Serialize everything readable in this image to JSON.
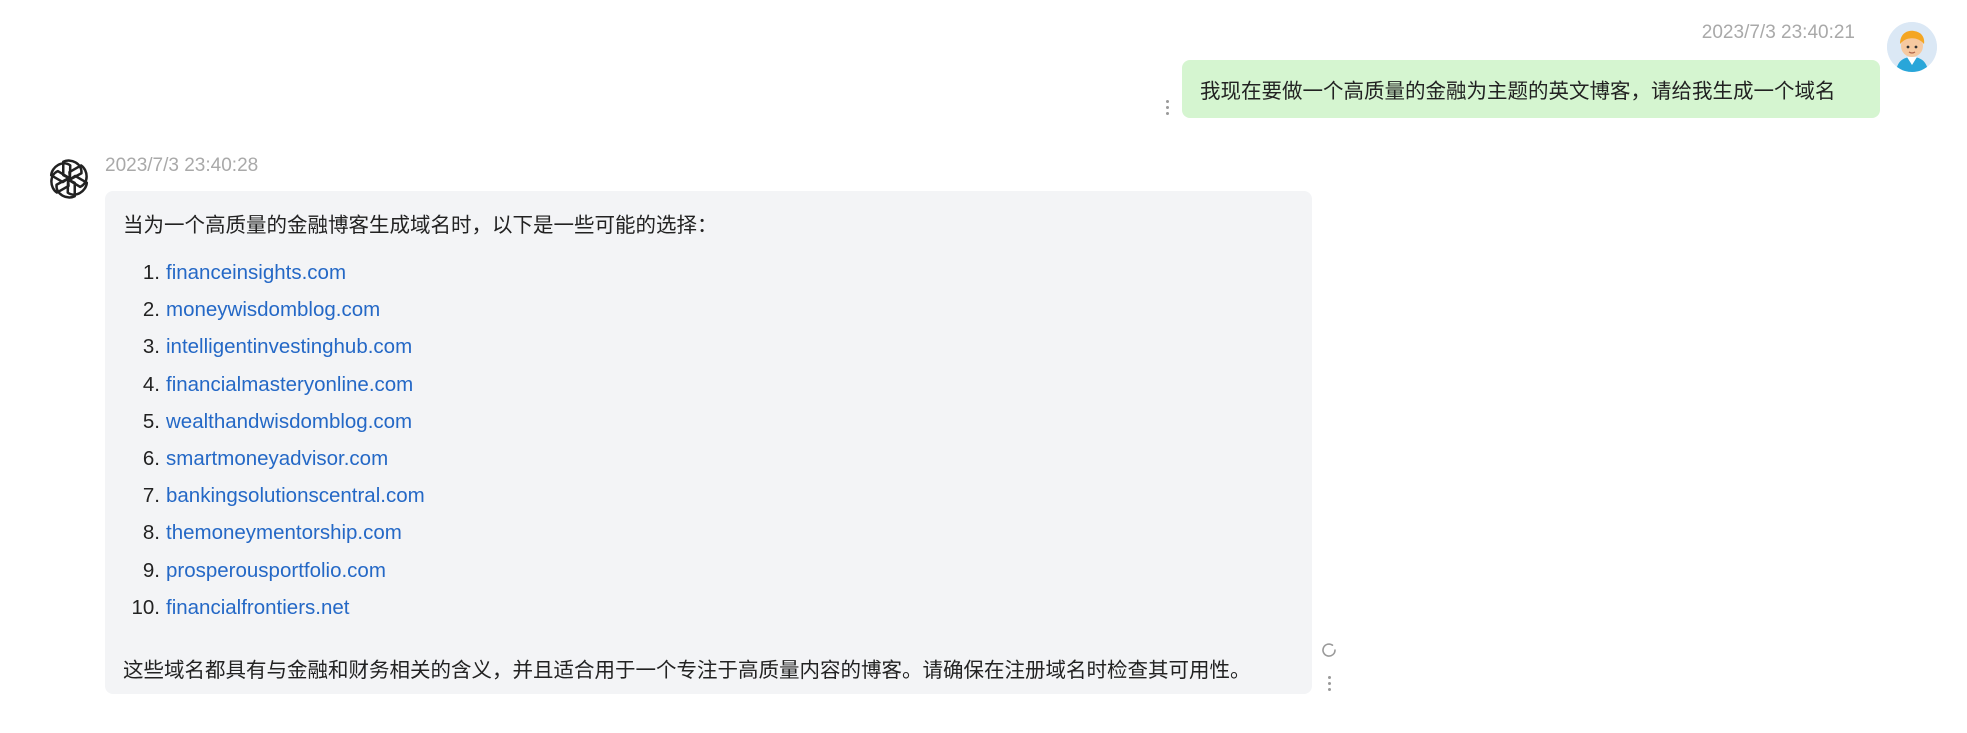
{
  "user_message": {
    "timestamp": "2023/7/3 23:40:21",
    "text": "我现在要做一个高质量的金融为主题的英文博客，请给我生成一个域名"
  },
  "assistant_message": {
    "timestamp": "2023/7/3 23:40:28",
    "intro": "当为一个高质量的金融博客生成域名时，以下是一些可能的选择：",
    "domains": [
      {
        "number": "1.",
        "text": "financeinsights.com"
      },
      {
        "number": "2.",
        "text": "moneywisdomblog.com"
      },
      {
        "number": "3.",
        "text": "intelligentinvestinghub.com"
      },
      {
        "number": "4.",
        "text": "financialmasteryonline.com"
      },
      {
        "number": "5.",
        "text": "wealthandwisdomblog.com"
      },
      {
        "number": "6.",
        "text": "smartmoneyadvisor.com"
      },
      {
        "number": "7.",
        "text": "bankingsolutionscentral.com"
      },
      {
        "number": "8.",
        "text": "themoneymentorship.com"
      },
      {
        "number": "9.",
        "text": "prosperousportfolio.com"
      },
      {
        "number": "10.",
        "text": "financialfrontiers.net"
      }
    ],
    "outro": "这些域名都具有与金融和财务相关的含义，并且适合用于一个专注于高质量内容的博客。请确保在注册域名时检查其可用性。"
  },
  "icons": {
    "user_avatar": "user-avatar-icon",
    "bot_avatar": "openai-logo-icon",
    "more": "more-vertical-icon",
    "refresh": "refresh-icon"
  },
  "colors": {
    "user_bubble": "#d5f5d0",
    "assistant_bubble": "#f3f4f6",
    "link": "#2468c6",
    "timestamp": "#a9a9a9"
  }
}
